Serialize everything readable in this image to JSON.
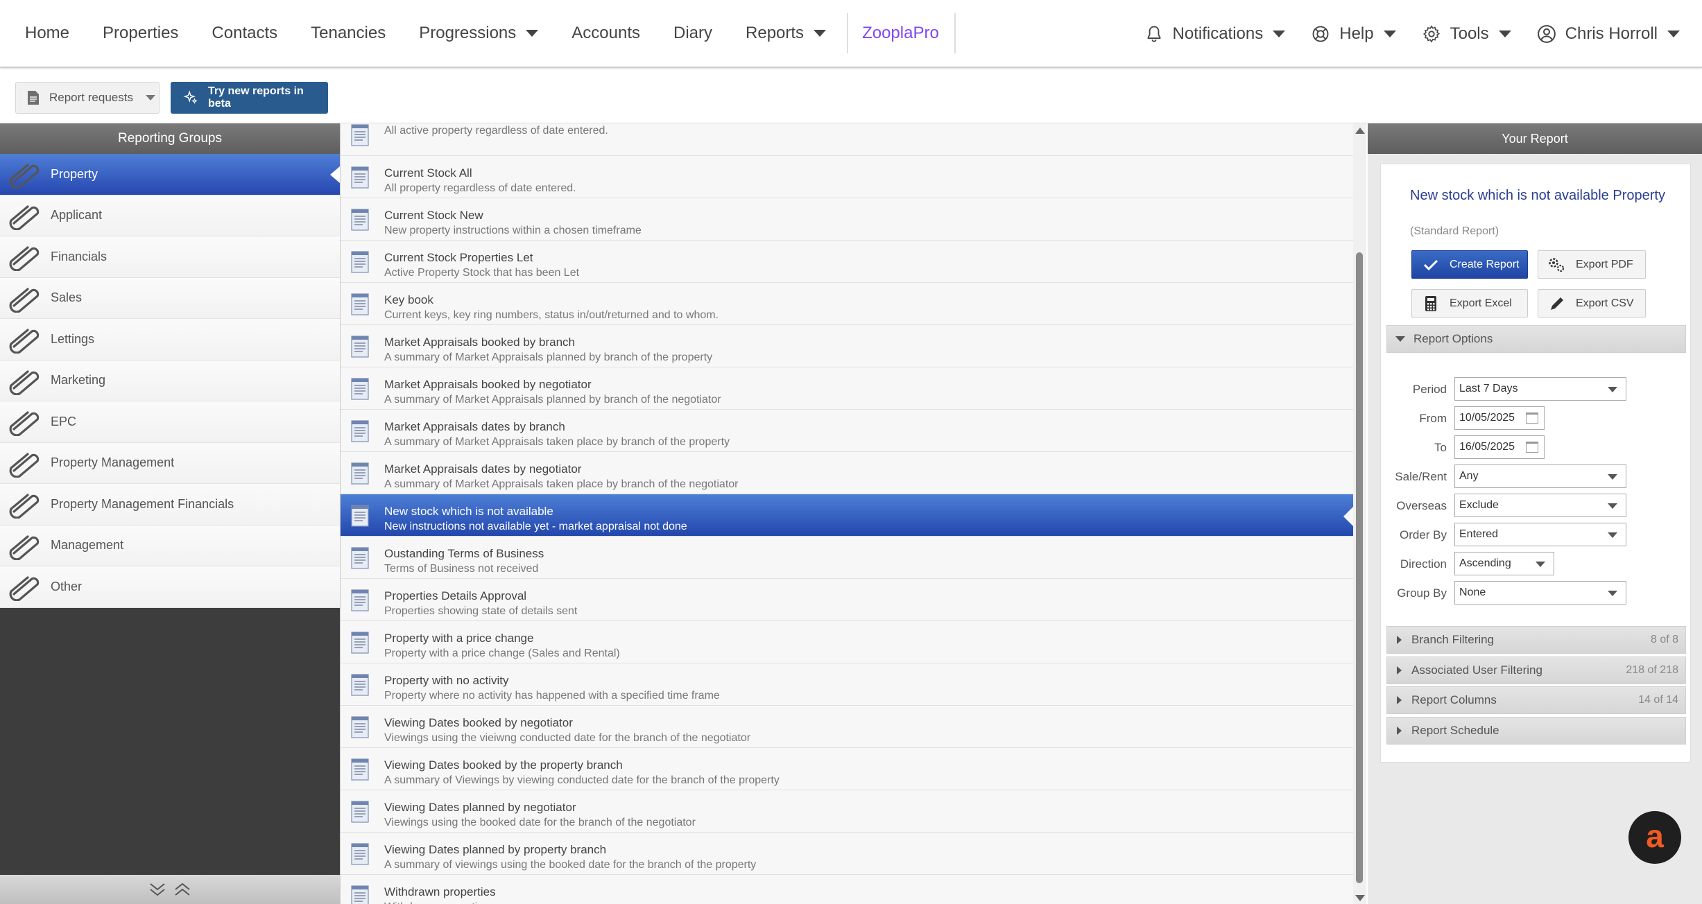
{
  "nav": {
    "home": "Home",
    "properties": "Properties",
    "contacts": "Contacts",
    "tenancies": "Tenancies",
    "progressions": "Progressions",
    "accounts": "Accounts",
    "diary": "Diary",
    "reports": "Reports",
    "zooplapro": "ZooplaPro",
    "notifications": "Notifications",
    "help": "Help",
    "tools": "Tools",
    "user": "Chris Horroll"
  },
  "toolbar": {
    "report_requests": "Report requests",
    "beta": "Try new reports in beta"
  },
  "left": {
    "header": "Reporting Groups",
    "groups": [
      {
        "label": "Property",
        "active": true
      },
      {
        "label": "Applicant"
      },
      {
        "label": "Financials"
      },
      {
        "label": "Sales"
      },
      {
        "label": "Lettings"
      },
      {
        "label": "Marketing"
      },
      {
        "label": "EPC"
      },
      {
        "label": "Property Management"
      },
      {
        "label": "Property Management Financials"
      },
      {
        "label": "Management"
      },
      {
        "label": "Other"
      }
    ]
  },
  "reports": [
    {
      "title": "",
      "desc": "All active property regardless of date entered."
    },
    {
      "title": "Current Stock All",
      "desc": "All property regardless of date entered."
    },
    {
      "title": "Current Stock New",
      "desc": "New property instructions within a chosen timeframe"
    },
    {
      "title": "Current Stock Properties Let",
      "desc": "Active Property Stock that has been Let"
    },
    {
      "title": "Key book",
      "desc": "Current keys, key ring numbers, status in/out/returned and to whom."
    },
    {
      "title": "Market Appraisals booked by branch",
      "desc": "A summary of Market Appraisals planned by branch of the property"
    },
    {
      "title": "Market Appraisals booked by negotiator",
      "desc": "A summary of Market Appraisals planned by branch of the negotiator"
    },
    {
      "title": "Market Appraisals dates by branch",
      "desc": "A summary of Market Appraisals taken place by branch of the property"
    },
    {
      "title": "Market Appraisals dates by negotiator",
      "desc": "A summary of Market Appraisals taken place by branch of the negotiator"
    },
    {
      "title": "New stock which is not available",
      "desc": "New instructions not available yet - market appraisal not done",
      "active": true
    },
    {
      "title": "Oustanding Terms of Business",
      "desc": "Terms of Business not received"
    },
    {
      "title": "Properties Details Approval",
      "desc": "Properties showing state of details sent"
    },
    {
      "title": "Property with a price change",
      "desc": "Property with a price change (Sales and Rental)"
    },
    {
      "title": "Property with no activity",
      "desc": "Property where no activity has happened with a specified time frame"
    },
    {
      "title": "Viewing Dates booked by negotiator",
      "desc": "Viewings using the vieiwng conducted date for the branch of the negotiator"
    },
    {
      "title": "Viewing Dates booked by the property branch",
      "desc": "A summary of Viewings by viewing conducted date for the branch of the property"
    },
    {
      "title": "Viewing Dates planned by negotiator",
      "desc": "Viewings using the booked date for the branch of the negotiator"
    },
    {
      "title": "Viewing Dates planned by property branch",
      "desc": "A summary of viewings using the booked date for the branch of the property"
    },
    {
      "title": "Withdrawn properties",
      "desc": "Withdrawn properties"
    }
  ],
  "right": {
    "header": "Your Report",
    "title": "New stock which is not available Property",
    "subtitle": "(Standard Report)",
    "buttons": {
      "create": "Create Report",
      "pdf": "Export PDF",
      "excel": "Export Excel",
      "csv": "Export CSV"
    },
    "options_header": "Report Options",
    "options": {
      "period_label": "Period",
      "period": "Last 7 Days",
      "from_label": "From",
      "from": "10/05/2025",
      "to_label": "To",
      "to": "16/05/2025",
      "salerent_label": "Sale/Rent",
      "salerent": "Any",
      "overseas_label": "Overseas",
      "overseas": "Exclude",
      "orderby_label": "Order By",
      "orderby": "Entered",
      "direction_label": "Direction",
      "direction": "Ascending",
      "groupby_label": "Group By",
      "groupby": "None"
    },
    "sections": [
      {
        "label": "Branch Filtering",
        "count": "8 of 8"
      },
      {
        "label": "Associated User Filtering",
        "count": "218 of 218"
      },
      {
        "label": "Report Columns",
        "count": "14 of 14"
      },
      {
        "label": "Report Schedule",
        "count": ""
      }
    ]
  },
  "colors": {
    "accent": "#2647b0",
    "zoopla": "#8046f1",
    "beta_button": "#2a5b8f",
    "fab": "#f15a24"
  }
}
